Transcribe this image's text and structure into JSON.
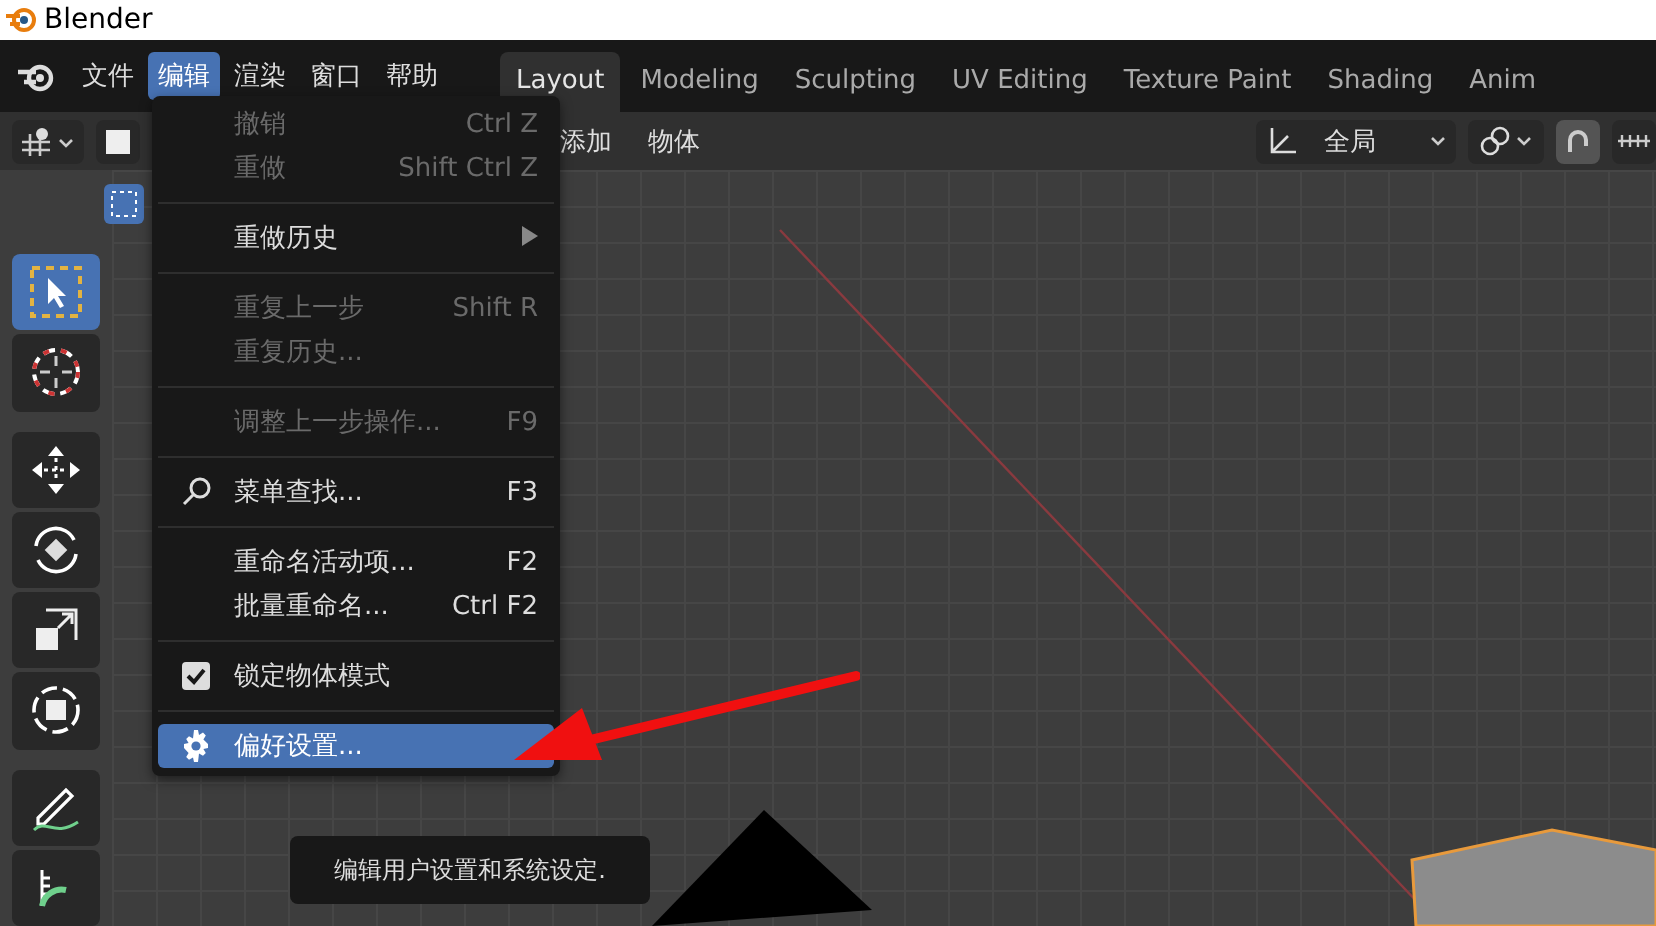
{
  "window": {
    "title": "Blender"
  },
  "menubar": [
    {
      "label": "文件",
      "selected": false
    },
    {
      "label": "编辑",
      "selected": true
    },
    {
      "label": "渲染",
      "selected": false
    },
    {
      "label": "窗口",
      "selected": false
    },
    {
      "label": "帮助",
      "selected": false
    }
  ],
  "workspace_tabs": [
    {
      "label": "Layout",
      "selected": true
    },
    {
      "label": "Modeling",
      "selected": false
    },
    {
      "label": "Sculpting",
      "selected": false
    },
    {
      "label": "UV Editing",
      "selected": false
    },
    {
      "label": "Texture Paint",
      "selected": false
    },
    {
      "label": "Shading",
      "selected": false
    },
    {
      "label": "Anim",
      "selected": false
    }
  ],
  "header": {
    "menus": [
      "添加",
      "物体"
    ],
    "orientation": "全局"
  },
  "toolbar": [
    {
      "kind": "select",
      "selected": true
    },
    {
      "kind": "cursor",
      "selected": false
    },
    {
      "kind": "move",
      "selected": false
    },
    {
      "kind": "rotate",
      "selected": false
    },
    {
      "kind": "scale",
      "selected": false
    },
    {
      "kind": "transform",
      "selected": false
    },
    {
      "kind": "annotate",
      "selected": false
    },
    {
      "kind": "measure",
      "selected": false
    }
  ],
  "edit_menu": {
    "items": [
      {
        "kind": "item",
        "label": "撤销",
        "shortcut": "Ctrl Z",
        "disabled": true,
        "selected": false
      },
      {
        "kind": "item",
        "label": "重做",
        "shortcut": "Shift Ctrl Z",
        "disabled": true,
        "selected": false
      },
      {
        "kind": "separator"
      },
      {
        "kind": "submenu",
        "label": "重做历史",
        "disabled": false,
        "selected": false
      },
      {
        "kind": "separator"
      },
      {
        "kind": "item",
        "label": "重复上一步",
        "shortcut": "Shift R",
        "disabled": true,
        "selected": false
      },
      {
        "kind": "item",
        "label": "重复历史...",
        "disabled": true,
        "selected": false
      },
      {
        "kind": "separator"
      },
      {
        "kind": "item",
        "label": "调整上一步操作...",
        "shortcut": "F9",
        "disabled": true,
        "selected": false
      },
      {
        "kind": "separator"
      },
      {
        "kind": "search",
        "label": "菜单查找...",
        "shortcut": "F3",
        "disabled": false,
        "selected": false
      },
      {
        "kind": "separator"
      },
      {
        "kind": "item",
        "label": "重命名活动项...",
        "shortcut": "F2",
        "disabled": false,
        "selected": false
      },
      {
        "kind": "item",
        "label": "批量重命名...",
        "shortcut": "Ctrl F2",
        "disabled": false,
        "selected": false
      },
      {
        "kind": "separator"
      },
      {
        "kind": "checkbox",
        "label": "锁定物体模式",
        "checked": true,
        "disabled": false,
        "selected": false
      },
      {
        "kind": "separator"
      },
      {
        "kind": "settings",
        "label": "偏好设置...",
        "disabled": false,
        "selected": true
      }
    ]
  },
  "tooltip": {
    "text": "编辑用户设置和系统设定."
  }
}
